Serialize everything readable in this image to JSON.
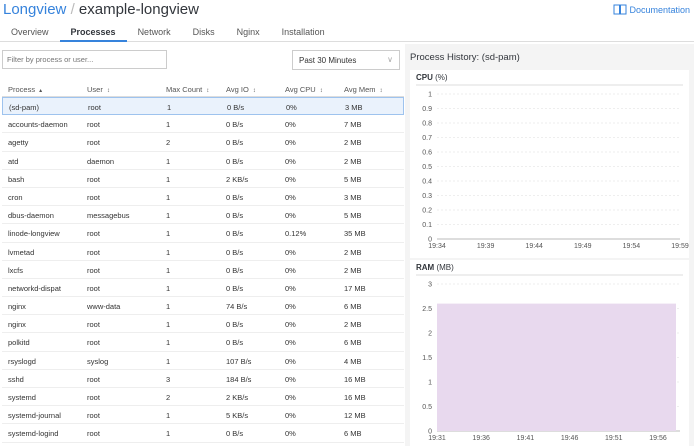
{
  "header": {
    "breadcrumb_root": "Longview",
    "separator": "/",
    "client": "example-longview",
    "documentation": "Documentation"
  },
  "tabs": [
    "Overview",
    "Processes",
    "Network",
    "Disks",
    "Nginx",
    "Installation"
  ],
  "active_tab": "Processes",
  "filter": {
    "placeholder": "Filter by process or user..."
  },
  "time_range": "Past 30 Minutes",
  "table": {
    "columns": [
      "Process",
      "User",
      "Max Count",
      "Avg IO",
      "Avg CPU",
      "Avg Mem"
    ],
    "rows": [
      [
        "(sd-pam)",
        "root",
        "1",
        "0 B/s",
        "0%",
        "3 MB"
      ],
      [
        "accounts-daemon",
        "root",
        "1",
        "0 B/s",
        "0%",
        "7 MB"
      ],
      [
        "agetty",
        "root",
        "2",
        "0 B/s",
        "0%",
        "2 MB"
      ],
      [
        "atd",
        "daemon",
        "1",
        "0 B/s",
        "0%",
        "2 MB"
      ],
      [
        "bash",
        "root",
        "1",
        "2 KB/s",
        "0%",
        "5 MB"
      ],
      [
        "cron",
        "root",
        "1",
        "0 B/s",
        "0%",
        "3 MB"
      ],
      [
        "dbus-daemon",
        "messagebus",
        "1",
        "0 B/s",
        "0%",
        "5 MB"
      ],
      [
        "linode-longview",
        "root",
        "1",
        "0 B/s",
        "0.12%",
        "35 MB"
      ],
      [
        "lvmetad",
        "root",
        "1",
        "0 B/s",
        "0%",
        "2 MB"
      ],
      [
        "lxcfs",
        "root",
        "1",
        "0 B/s",
        "0%",
        "2 MB"
      ],
      [
        "networkd-dispat",
        "root",
        "1",
        "0 B/s",
        "0%",
        "17 MB"
      ],
      [
        "nginx",
        "www-data",
        "1",
        "74 B/s",
        "0%",
        "6 MB"
      ],
      [
        "nginx",
        "root",
        "1",
        "0 B/s",
        "0%",
        "2 MB"
      ],
      [
        "polkitd",
        "root",
        "1",
        "0 B/s",
        "0%",
        "6 MB"
      ],
      [
        "rsyslogd",
        "syslog",
        "1",
        "107 B/s",
        "0%",
        "4 MB"
      ],
      [
        "sshd",
        "root",
        "3",
        "184 B/s",
        "0%",
        "16 MB"
      ],
      [
        "systemd",
        "root",
        "2",
        "2 KB/s",
        "0%",
        "16 MB"
      ],
      [
        "systemd-journal",
        "root",
        "1",
        "5 KB/s",
        "0%",
        "12 MB"
      ],
      [
        "systemd-logind",
        "root",
        "1",
        "0 B/s",
        "0%",
        "6 MB"
      ]
    ]
  },
  "history": {
    "title": "Process History: (sd-pam)"
  },
  "chart_data": [
    {
      "type": "line",
      "title": "CPU",
      "unit": "(%)",
      "x": [
        "19:34",
        "19:39",
        "19:44",
        "19:49",
        "19:54",
        "19:59"
      ],
      "ylim": [
        0,
        1
      ],
      "yticks": [
        "0",
        "0.1",
        "0.2",
        "0.3",
        "0.4",
        "0.5",
        "0.6",
        "0.7",
        "0.8",
        "0.9",
        "1"
      ],
      "values": [],
      "grid": true
    },
    {
      "type": "area",
      "title": "RAM",
      "unit": "(MB)",
      "x": [
        "19:31",
        "19:36",
        "19:41",
        "19:46",
        "19:51",
        "19:56"
      ],
      "ylim": [
        0,
        3
      ],
      "yticks": [
        "0",
        "0.5",
        "1",
        "1.5",
        "2",
        "2.5",
        "3"
      ],
      "values": [
        2.6,
        2.6
      ],
      "color": "#e8d9ee",
      "grid": true
    }
  ]
}
